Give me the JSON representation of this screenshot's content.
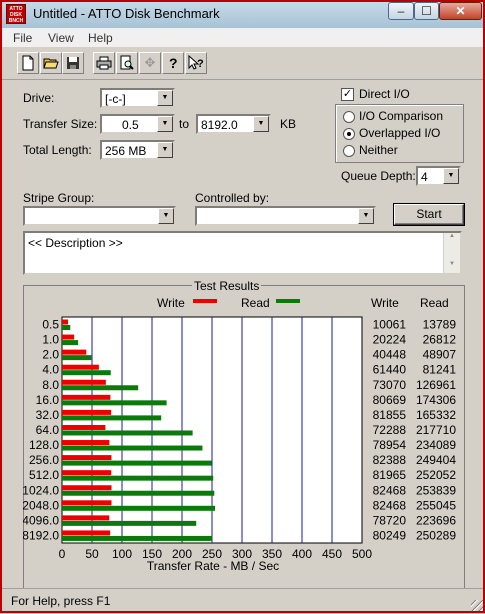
{
  "window": {
    "title": "Untitled - ATTO Disk Benchmark",
    "icon_lines": [
      "ATTO",
      "DISK",
      "BNCH"
    ]
  },
  "caption_buttons": {
    "minimize": "–",
    "maximize": "☐",
    "close": "✕"
  },
  "menu": [
    "File",
    "View",
    "Help"
  ],
  "toolbar_icons": [
    "new-file",
    "open-folder",
    "save",
    "print",
    "print-preview",
    "move",
    "help",
    "context-help"
  ],
  "form": {
    "drive_label": "Drive:",
    "drive_value": "[-c-]",
    "transfer_size_label": "Transfer Size:",
    "transfer_from": "0.5",
    "to_label": "to",
    "transfer_to": "8192.0",
    "kb_label": "KB",
    "total_length_label": "Total Length:",
    "total_length_value": "256 MB",
    "direct_io_label": "Direct I/O",
    "direct_io_checked": true,
    "io_options": [
      "I/O Comparison",
      "Overlapped I/O",
      "Neither"
    ],
    "io_selected": "Overlapped I/O",
    "queue_depth_label": "Queue Depth:",
    "queue_depth_value": "4",
    "stripe_group_label": "Stripe Group:",
    "stripe_group_value": "",
    "controlled_by_label": "Controlled by:",
    "controlled_by_value": "",
    "start_label": "Start",
    "description": "<< Description >>"
  },
  "results": {
    "title": "Test Results",
    "write_legend": "Write",
    "read_legend": "Read",
    "write_col": "Write",
    "read_col": "Read"
  },
  "chart_data": {
    "type": "bar",
    "orientation": "horizontal",
    "categories": [
      "0.5",
      "1.0",
      "2.0",
      "4.0",
      "8.0",
      "16.0",
      "32.0",
      "64.0",
      "128.0",
      "256.0",
      "512.0",
      "1024.0",
      "2048.0",
      "4096.0",
      "8192.0"
    ],
    "series": [
      {
        "name": "Write",
        "color": "#ee0000",
        "values": [
          10061,
          20224,
          40448,
          61440,
          73070,
          80669,
          81855,
          72288,
          78954,
          82388,
          81965,
          82468,
          82468,
          78720,
          80249
        ]
      },
      {
        "name": "Read",
        "color": "#0b7a0b",
        "values": [
          13789,
          26812,
          48907,
          81241,
          126961,
          174306,
          165332,
          217710,
          234089,
          249404,
          252052,
          253839,
          255045,
          223696,
          250289
        ]
      }
    ],
    "xlabel": "Transfer Rate - MB / Sec",
    "xticks": [
      0,
      50,
      100,
      150,
      200,
      250,
      300,
      350,
      400,
      450,
      500
    ],
    "xlim": [
      0,
      500
    ]
  },
  "status": {
    "text": "For Help, press F1"
  }
}
